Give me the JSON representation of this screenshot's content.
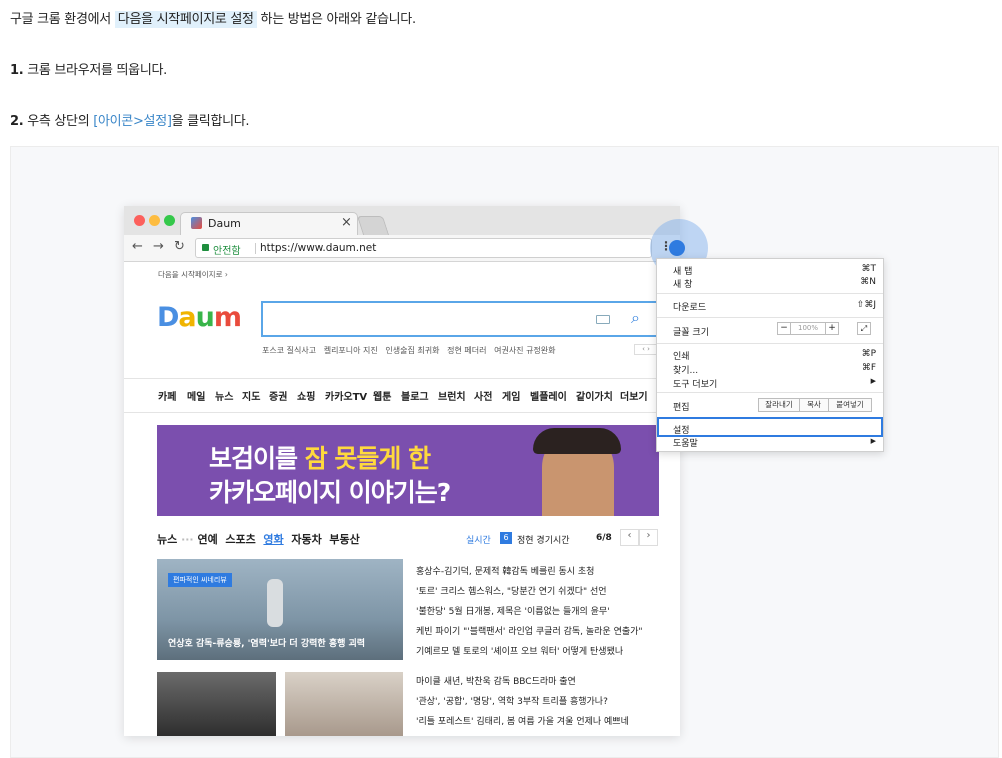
{
  "intro": {
    "text_a": "구글 크롬 환경에서 ",
    "highlight": "다음을 시작페이지로 설정",
    "text_b": " 하는 방법은 아래와 같습니다."
  },
  "step1": {
    "num": "1.",
    "text": " 크롬 브라우저를 띄웁니다."
  },
  "step2": {
    "num": "2.",
    "text_a": " 우측 상단의 ",
    "link": "[아이콘>설정]",
    "text_b": "을 클릭합니다."
  },
  "browser": {
    "tab_title": "Daum",
    "tab_close": "×",
    "secure_label": "안전함",
    "url": "https://www.daum.net",
    "top_link": "다음을 시작페이지로 ›",
    "logo": "Daum",
    "keywords": [
      "포스코 질식사고",
      "켈리포니아 지진",
      "인생술집 최귀화",
      "정현 페더러",
      "여권사진 규정완화"
    ],
    "nav": [
      "카페",
      "메일",
      "뉴스",
      "지도",
      "증권",
      "쇼핑",
      "카카오TV",
      "웹툰",
      "블로그",
      "브런치",
      "사전",
      "게임",
      "벨플레이",
      "같이가치",
      "더보기"
    ],
    "banner": {
      "line1_a": "보검이를 ",
      "line1_b": "잠 못들게 한",
      "line2": "카카오페이지 이야기는?"
    },
    "news_tabs": [
      "뉴스",
      "연예",
      "스포츠",
      "영화",
      "자동차",
      "부동산"
    ],
    "realtime": "실시간",
    "rank": "6",
    "rank_text": "정현 경기시간",
    "page": "6/8",
    "feature_badge": "편파적인 씨네리뷰",
    "feature_caption": "연상호 감독-류승룡, '염력'보다 더 강력한 흥행 괴력",
    "headlines": [
      "홍상수-김기덕, 문제적 韓감독 베를린 동시 초청",
      "'토르' 크리스 헴스워스, \"당분간 연기 쉬겠다\" 선언",
      "'불한당' 5월 日개봉, 제목은 '이름없는 들개의 윤무'",
      "케빈 파이기 \"'블랙팬서' 라인업 쿠글러 감독, 놀라운 연출가\"",
      "기예르모 델 토로의 '셰이프 오브 워터' 어떻게 탄생됐나",
      "마이클 새년, 박찬욱 감독 BBC드라마 출연",
      "'관상', '공합', '명당', 역학 3부작 트리플 흥행가나?",
      "'리틀 포레스트' 김태리, 봄 여름 가을 겨울 언제나 예쁘네"
    ]
  },
  "menu": {
    "new_tab": "새 탭",
    "new_tab_sc": "⌘T",
    "new_window": "새 창",
    "new_window_sc": "⌘N",
    "downloads": "다운로드",
    "downloads_sc": "⇧⌘J",
    "font_size": "글꼴 크기",
    "zoom_minus": "−",
    "zoom": "100%",
    "zoom_plus": "+",
    "print": "인쇄",
    "print_sc": "⌘P",
    "find": "찾기...",
    "find_sc": "⌘F",
    "more_tools": "도구 더보기",
    "arrow": "▶",
    "edit": "편집",
    "cut": "잘라내기",
    "copy": "복사",
    "paste": "붙여넣기",
    "settings": "설정",
    "help": "도움말"
  },
  "colors": {
    "accent": "#2f7be0",
    "highlight": "#e0f0fb",
    "banner_bg": "#7b4fae",
    "banner_yellow": "#ffd93d",
    "link": "#3a86c8"
  }
}
